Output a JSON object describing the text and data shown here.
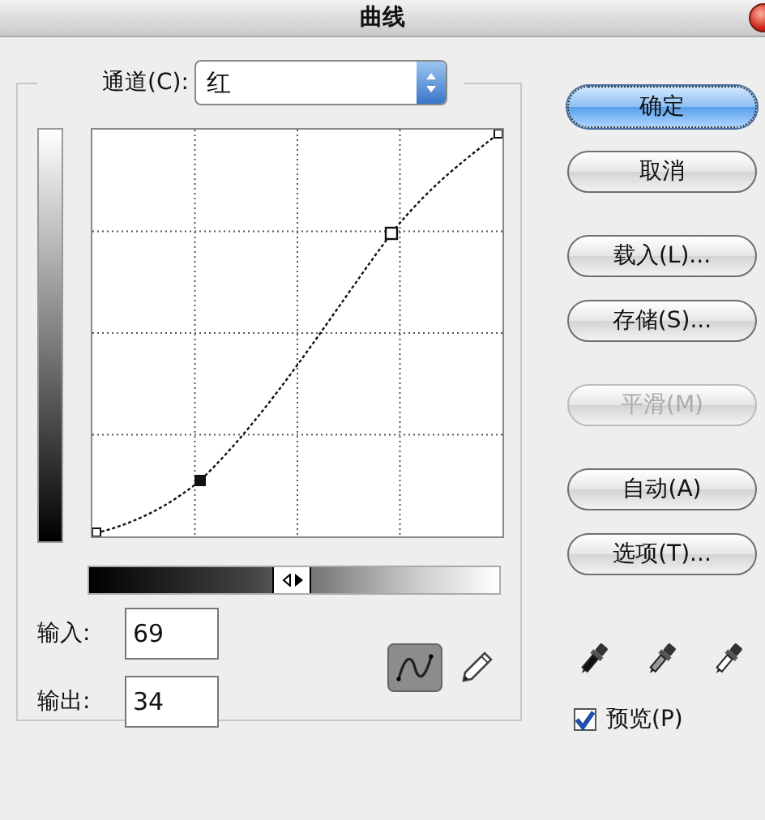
{
  "window": {
    "title": "曲线"
  },
  "channel": {
    "label": "通道(C):",
    "value": "红"
  },
  "input": {
    "label": "输入:",
    "value": "69"
  },
  "output": {
    "label": "输出:",
    "value": "34"
  },
  "tools": [
    {
      "kind": "curve",
      "selected": true
    },
    {
      "kind": "pencil",
      "selected": false
    }
  ],
  "buttons": [
    {
      "label": "确定",
      "default": true,
      "disabled": false
    },
    {
      "label": "取消",
      "default": false,
      "disabled": false
    },
    {
      "label": "载入(L)...",
      "default": false,
      "disabled": false
    },
    {
      "label": "存储(S)...",
      "default": false,
      "disabled": false
    },
    {
      "label": "平滑(M)",
      "default": false,
      "disabled": true
    },
    {
      "label": "自动(A)",
      "default": false,
      "disabled": false
    },
    {
      "label": "选项(T)...",
      "default": false,
      "disabled": false
    }
  ],
  "eyedroppers": [
    {
      "kind": "black"
    },
    {
      "kind": "gray"
    },
    {
      "kind": "white"
    }
  ],
  "preview": {
    "label": "预览(P)",
    "checked": true
  }
}
